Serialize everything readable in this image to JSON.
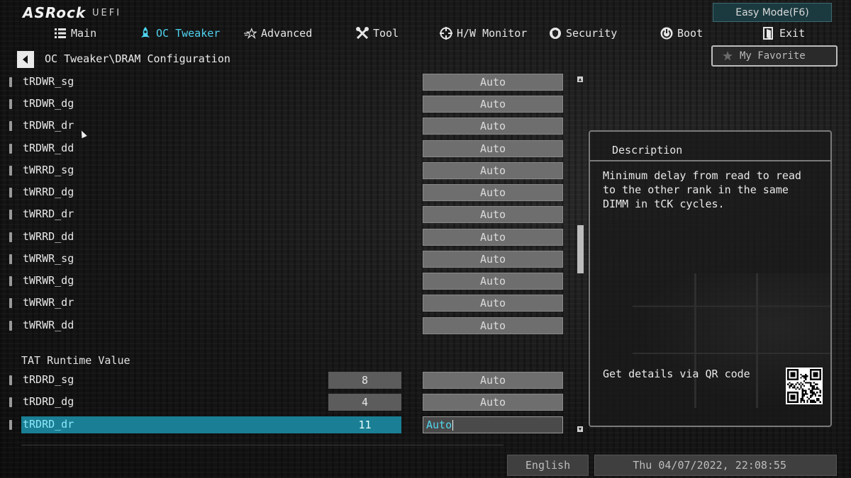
{
  "brand": {
    "logo": "ASRock",
    "sub": "UEFI"
  },
  "easy_mode": "Easy Mode(F6)",
  "nav": [
    {
      "label": "Main",
      "icon": "list-icon"
    },
    {
      "label": "OC Tweaker",
      "icon": "rocket-icon",
      "active": true
    },
    {
      "label": "Advanced",
      "icon": "star-icon"
    },
    {
      "label": "Tool",
      "icon": "tools-icon"
    },
    {
      "label": "H/W Monitor",
      "icon": "crosshair-icon"
    },
    {
      "label": "Security",
      "icon": "shield-icon"
    },
    {
      "label": "Boot",
      "icon": "power-icon"
    },
    {
      "label": "Exit",
      "icon": "exit-icon"
    }
  ],
  "breadcrumb": "OC Tweaker\\DRAM Configuration",
  "favorite": "My Favorite",
  "settings": [
    {
      "label": "tRDWR_sg",
      "value": "Auto"
    },
    {
      "label": "tRDWR_dg",
      "value": "Auto"
    },
    {
      "label": "tRDWR_dr",
      "value": "Auto"
    },
    {
      "label": "tRDWR_dd",
      "value": "Auto"
    },
    {
      "label": "tWRRD_sg",
      "value": "Auto"
    },
    {
      "label": "tWRRD_dg",
      "value": "Auto"
    },
    {
      "label": "tWRRD_dr",
      "value": "Auto"
    },
    {
      "label": "tWRRD_dd",
      "value": "Auto"
    },
    {
      "label": "tWRWR_sg",
      "value": "Auto"
    },
    {
      "label": "tWRWR_dg",
      "value": "Auto"
    },
    {
      "label": "tWRWR_dr",
      "value": "Auto"
    },
    {
      "label": "tWRWR_dd",
      "value": "Auto"
    }
  ],
  "tat_section": "TAT Runtime Value",
  "tat_rows": [
    {
      "label": "tRDRD_sg",
      "current": "8",
      "value": "Auto"
    },
    {
      "label": "tRDRD_dg",
      "current": "4",
      "value": "Auto"
    },
    {
      "label": "tRDRD_dr",
      "current": "11",
      "value": "Auto",
      "selected": true
    }
  ],
  "description": {
    "title": "Description",
    "text": "Minimum delay from read to read to the other rank in the same DIMM in tCK cycles.",
    "qr_text": "Get details via QR code"
  },
  "language": "English",
  "datetime": "Thu 04/07/2022, 22:08:55",
  "colors": {
    "accent": "#4fd2ee",
    "selected_row": "#1a7f94"
  }
}
